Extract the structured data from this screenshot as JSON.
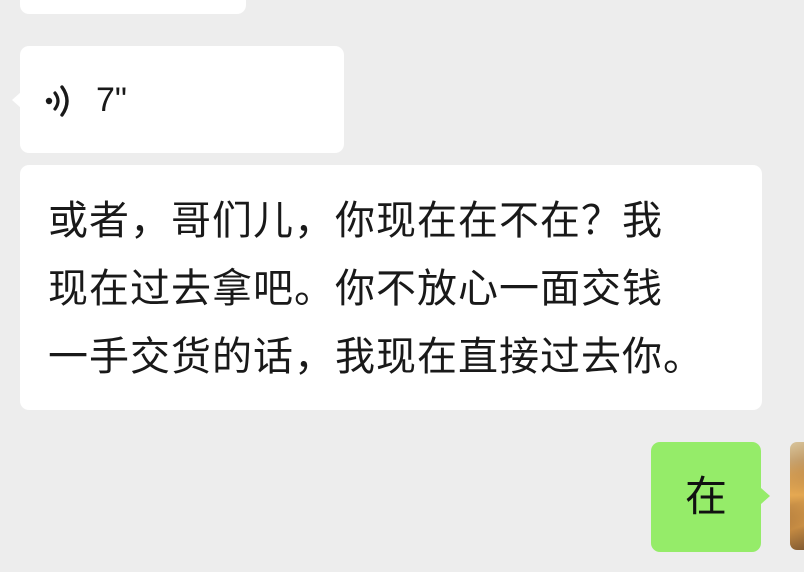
{
  "chat": {
    "messages": [
      {
        "type": "text",
        "direction": "incoming",
        "text": ""
      },
      {
        "type": "voice",
        "direction": "incoming",
        "icon": "voice-wave-icon",
        "duration": "7\""
      },
      {
        "type": "text",
        "direction": "incoming",
        "text": "或者，哥们儿，你现在在不在？我\n现在过去拿吧。你不放心一面交钱\n一手交货的话，我现在直接过去你。"
      },
      {
        "type": "text",
        "direction": "outgoing",
        "text": "在"
      }
    ]
  },
  "colors": {
    "background": "#ededed",
    "incoming_bubble": "#ffffff",
    "outgoing_bubble": "#95ec69",
    "text": "#191919"
  }
}
